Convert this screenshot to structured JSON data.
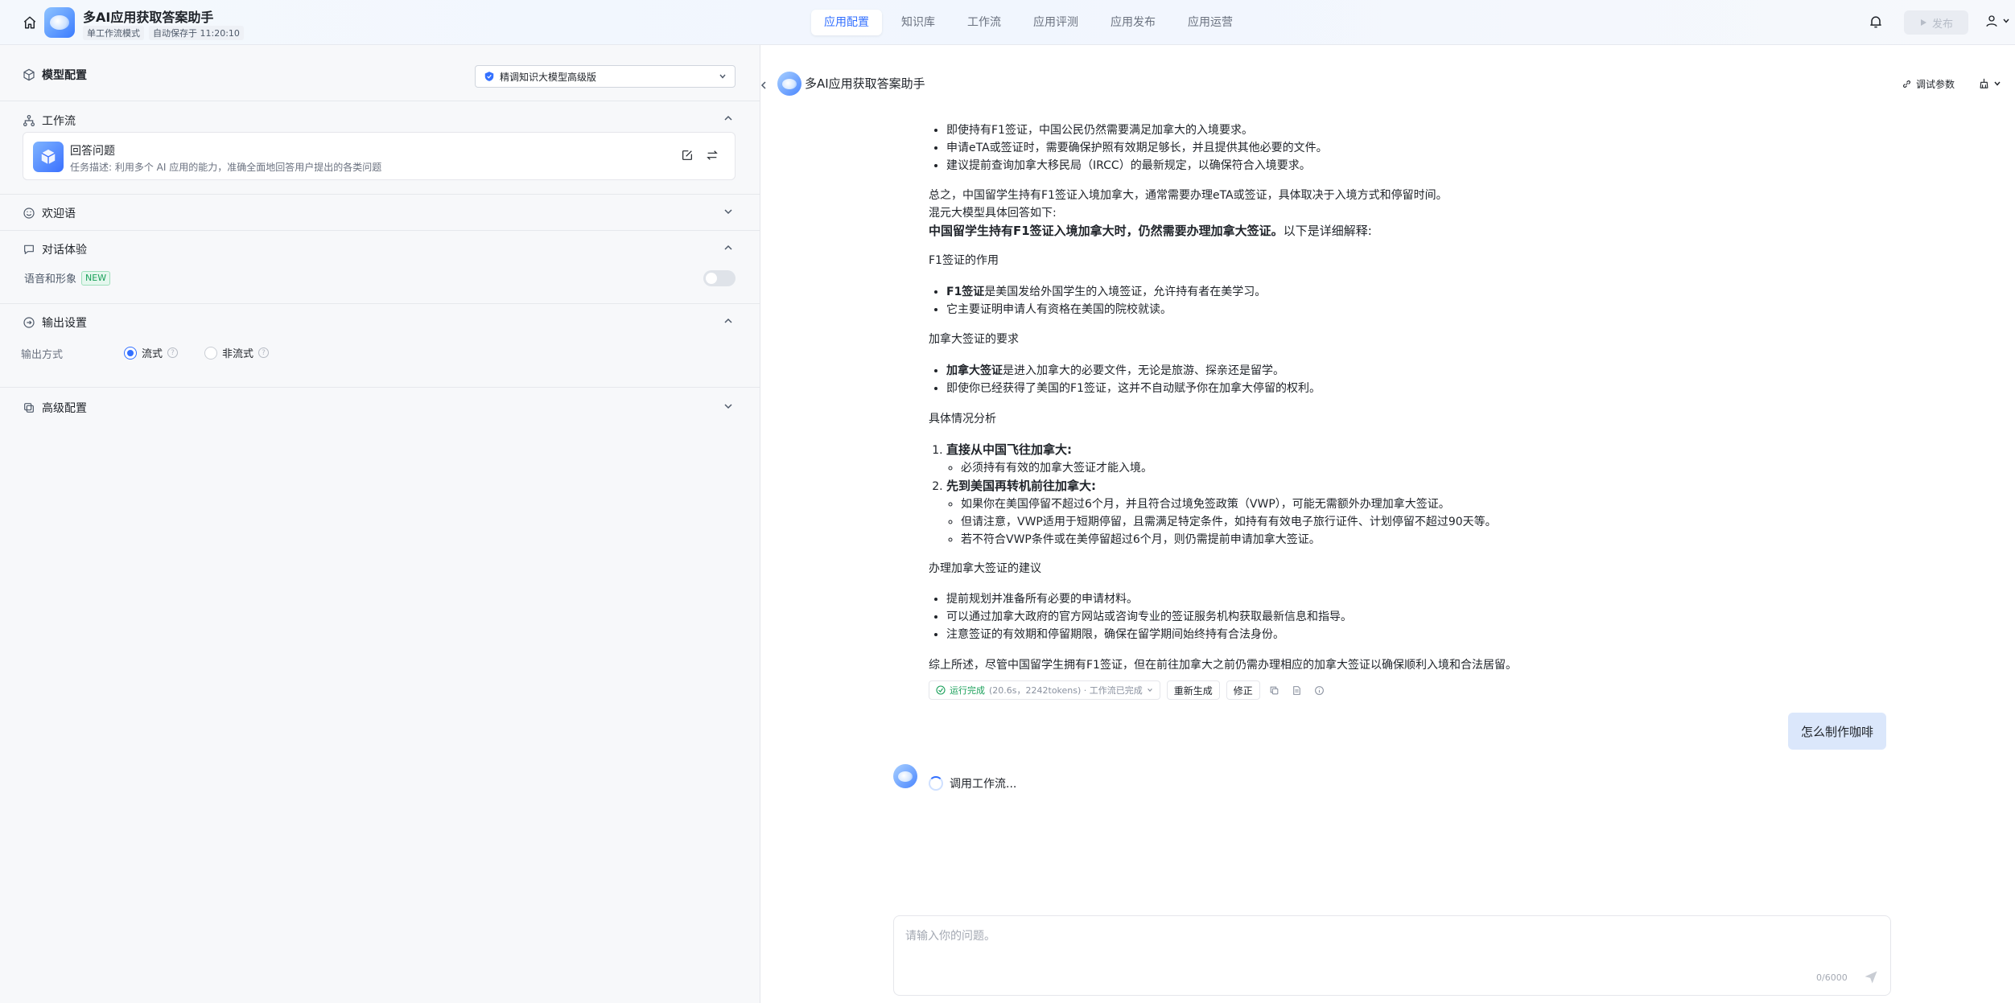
{
  "header": {
    "app_title": "多AI应用获取答案助手",
    "mode_tag": "单工作流模式",
    "autosave": "自动保存于 11:20:10",
    "tabs": [
      {
        "label": "应用配置"
      },
      {
        "label": "知识库"
      },
      {
        "label": "工作流"
      },
      {
        "label": "应用评测"
      },
      {
        "label": "应用发布"
      },
      {
        "label": "应用运营"
      }
    ],
    "active_tab": "应用配置",
    "publish_label": "发布",
    "accent_color": "#3370ff"
  },
  "config": {
    "model": {
      "title": "模型配置",
      "selected": "精调知识大模型高级版"
    },
    "workflow": {
      "title": "工作流",
      "card_name": "回答问题",
      "card_desc": "任务描述: 利用多个 AI 应用的能力，准确全面地回答用户提出的各类问题"
    },
    "welcome": {
      "title": "欢迎语"
    },
    "dialog": {
      "title": "对话体验",
      "voice_label": "语音和形象",
      "new_badge": "NEW",
      "voice_enabled": false
    },
    "output": {
      "title": "输出设置",
      "label": "输出方式",
      "options": [
        {
          "label": "流式"
        },
        {
          "label": "非流式"
        }
      ],
      "selected": "流式"
    },
    "advanced": {
      "title": "高级配置"
    }
  },
  "chat": {
    "title": "多AI应用获取答案助手",
    "debug_params": "调试参数",
    "top_bullets": [
      "即使持有F1签证，中国公民仍然需要满足加拿大的入境要求。",
      "申请eTA或签证时，需要确保护照有效期足够长，并且提供其他必要的文件。",
      "建议提前查询加拿大移民局（IRCC）的最新规定，以确保符合入境要求。"
    ],
    "summary1": "总之，中国留学生持有F1签证入境加拿大，通常需要办理eTA或签证，具体取决于入境方式和停留时间。",
    "intro": "混元大模型具体回答如下:",
    "lead_bold": "中国留学生持有F1签证入境加拿大时，仍然需要办理加拿大签证。",
    "lead_rest": "以下是详细解释:",
    "sections": {
      "f1_title": "F1签证的作用",
      "f1_items": [
        {
          "bold": "F1签证",
          "text": "是美国发给外国学生的入境签证，允许持有者在美学习。"
        },
        {
          "bold": "",
          "text": "它主要证明申请人有资格在美国的院校就读。"
        }
      ],
      "ca_title": "加拿大签证的要求",
      "ca_items": [
        {
          "bold": "加拿大签证",
          "text": "是进入加拿大的必要文件，无论是旅游、探亲还是留学。"
        },
        {
          "bold": "",
          "text": "即使你已经获得了美国的F1签证，这并不自动赋予你在加拿大停留的权利。"
        }
      ],
      "analysis_title": "具体情况分析",
      "case1_title": "直接从中国飞往加拿大:",
      "case1_items": [
        "必须持有有效的加拿大签证才能入境。"
      ],
      "case2_title": "先到美国再转机前往加拿大:",
      "case2_items": [
        "如果你在美国停留不超过6个月，并且符合过境免签政策（VWP），可能无需额外办理加拿大签证。",
        "但请注意，VWP适用于短期停留，且需满足特定条件，如持有有效电子旅行证件、计划停留不超过90天等。",
        "若不符合VWP条件或在美停留超过6个月，则仍需提前申请加拿大签证。"
      ],
      "advice_title": "办理加拿大签证的建议",
      "advice_items": [
        "提前规划并准备所有必要的申请材料。",
        "可以通过加拿大政府的官方网站或咨询专业的签证服务机构获取最新信息和指导。",
        "注意签证的有效期和停留期限，确保在留学期间始终持有合法身份。"
      ]
    },
    "conclusion": "综上所述，尽管中国留学生拥有F1签证，但在前往加拿大之前仍需办理相应的加拿大签证以确保顺利入境和合法居留。",
    "run_status": "运行完成",
    "run_meta": "(20.6s，2242tokens) · 工作流已完成",
    "regenerate": "重新生成",
    "correct": "修正",
    "user_message": "怎么制作咖啡",
    "calling_text": "调用工作流...",
    "input_placeholder": "请输入你的问题。",
    "input_value": "",
    "counter": "0/6000"
  }
}
